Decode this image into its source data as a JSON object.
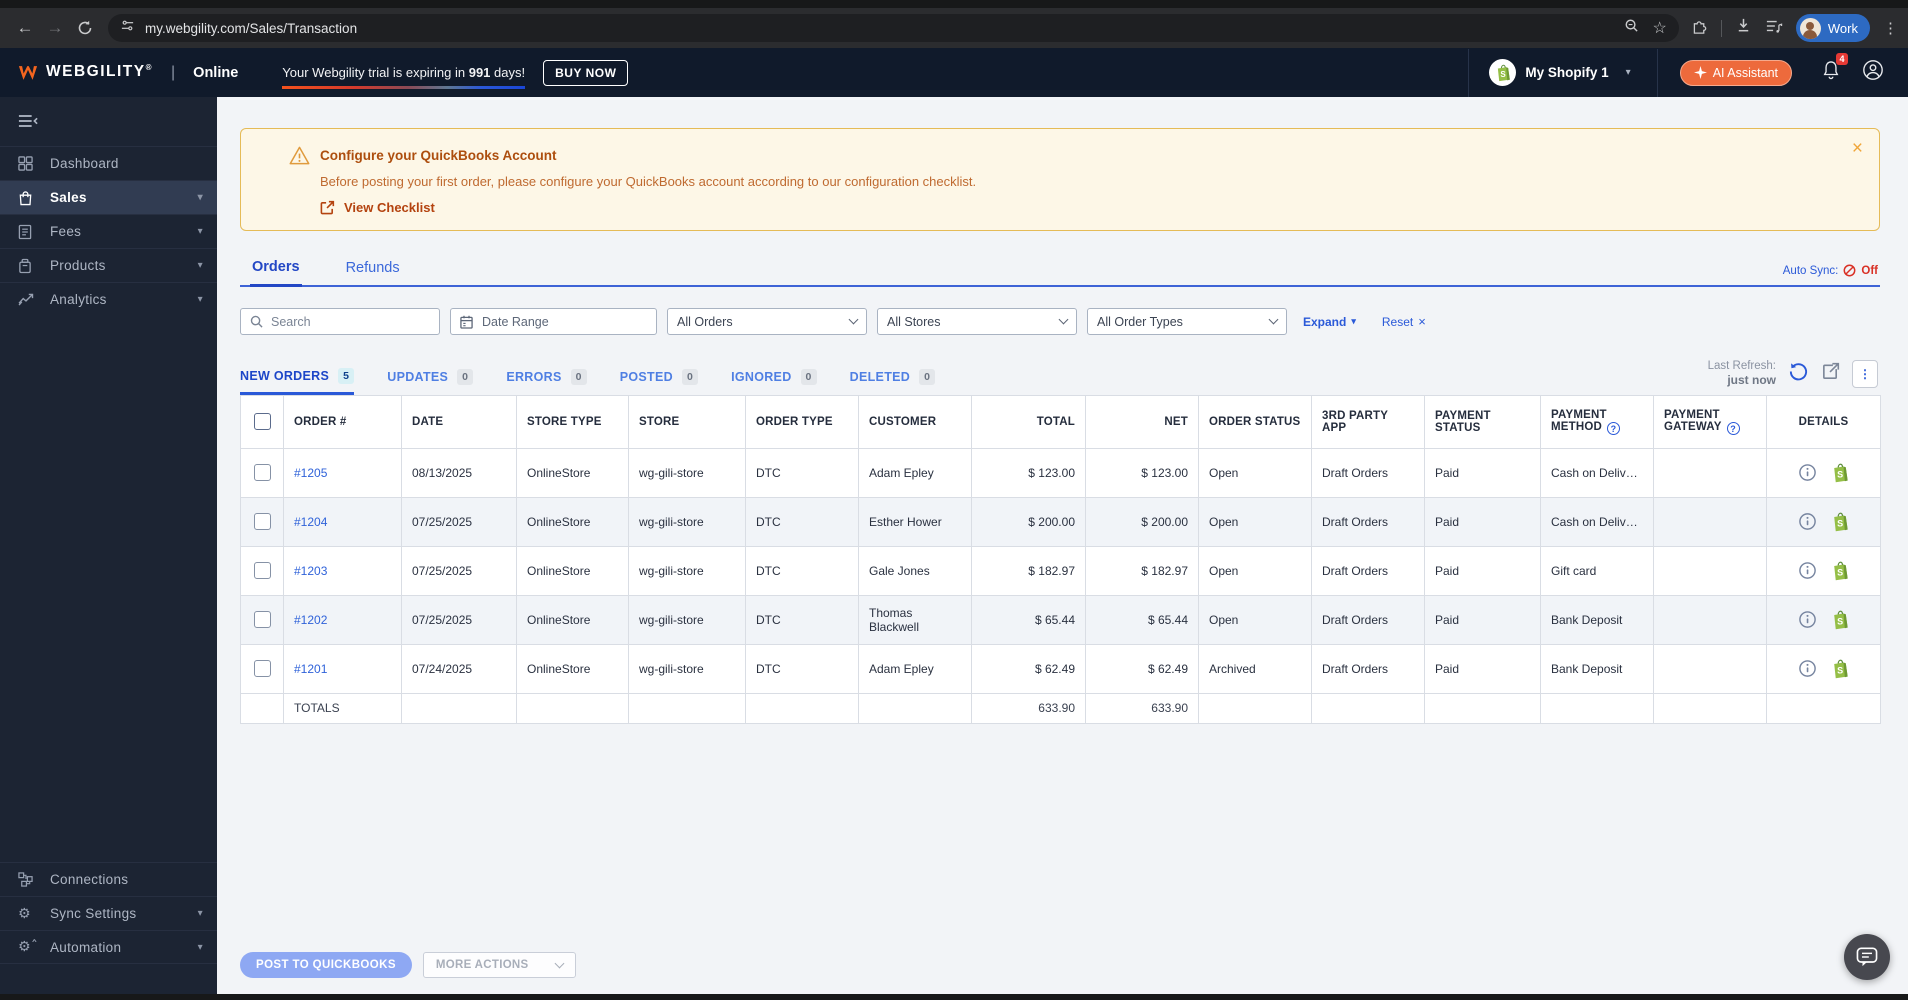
{
  "colors": {
    "brand_orange": "#f4651f",
    "accent_blue": "#2a59d8",
    "auto_sync_off_red": "#d93025",
    "shopify_green": "#95bf47",
    "banner_border": "#e5bb57",
    "header_navy": "#101a2b"
  },
  "browser": {
    "url": "my.webgility.com/Sales/Transaction",
    "profile": "Work"
  },
  "header": {
    "brand": "WEBGILITY",
    "reg": "®",
    "divider": "|",
    "mode": "Online",
    "trial_prefix": "Your Webgility trial is expiring in ",
    "trial_days": "991",
    "trial_suffix": " days!",
    "buy_now": "BUY NOW",
    "store": "My Shopify 1",
    "ai_assistant": "AI Assistant",
    "bell_count": "4"
  },
  "sidebar": {
    "items": [
      {
        "label": "Dashboard"
      },
      {
        "label": "Sales"
      },
      {
        "label": "Fees"
      },
      {
        "label": "Products"
      },
      {
        "label": "Analytics"
      }
    ],
    "bottom_items": [
      {
        "label": "Connections"
      },
      {
        "label": "Sync Settings"
      },
      {
        "label": "Automation"
      }
    ]
  },
  "banner": {
    "title": "Configure your QuickBooks Account",
    "body": "Before posting your first order, please configure your QuickBooks account according to our configuration checklist.",
    "link": "View Checklist"
  },
  "page_tabs": [
    {
      "label": "Orders"
    },
    {
      "label": "Refunds"
    }
  ],
  "auto_sync": {
    "label": "Auto Sync:",
    "value": "Off"
  },
  "filters": {
    "search_placeholder": "Search",
    "date_range": "Date Range",
    "orders_filter": "All Orders",
    "stores_filter": "All Stores",
    "order_types_filter": "All Order Types",
    "expand": "Expand",
    "reset": "Reset"
  },
  "subtabs": [
    {
      "label": "NEW ORDERS",
      "count": "5"
    },
    {
      "label": "UPDATES",
      "count": "0"
    },
    {
      "label": "ERRORS",
      "count": "0"
    },
    {
      "label": "POSTED",
      "count": "0"
    },
    {
      "label": "IGNORED",
      "count": "0"
    },
    {
      "label": "DELETED",
      "count": "0"
    }
  ],
  "refresh": {
    "label": "Last Refresh:",
    "value": "just now"
  },
  "table": {
    "columns": [
      "ORDER #",
      "DATE",
      "STORE TYPE",
      "STORE",
      "ORDER TYPE",
      "CUSTOMER",
      "TOTAL",
      "NET",
      "ORDER STATUS",
      "3RD PARTY APP",
      "PAYMENT STATUS",
      "PAYMENT METHOD",
      "PAYMENT GATEWAY",
      "DETAILS"
    ],
    "rows": [
      {
        "order_no": "#1205",
        "date": "08/13/2025",
        "store_type": "OnlineStore",
        "store": "wg-gili-store",
        "order_type": "DTC",
        "customer": "Adam Epley",
        "total": "$ 123.00",
        "net": "$ 123.00",
        "order_status": "Open",
        "third_party_app": "Draft Orders",
        "payment_status": "Paid",
        "payment_method": "Cash on Delivery …",
        "payment_gateway": ""
      },
      {
        "order_no": "#1204",
        "date": "07/25/2025",
        "store_type": "OnlineStore",
        "store": "wg-gili-store",
        "order_type": "DTC",
        "customer": "Esther Hower",
        "total": "$ 200.00",
        "net": "$ 200.00",
        "order_status": "Open",
        "third_party_app": "Draft Orders",
        "payment_status": "Paid",
        "payment_method": "Cash on Delivery …",
        "payment_gateway": ""
      },
      {
        "order_no": "#1203",
        "date": "07/25/2025",
        "store_type": "OnlineStore",
        "store": "wg-gili-store",
        "order_type": "DTC",
        "customer": "Gale Jones",
        "total": "$ 182.97",
        "net": "$ 182.97",
        "order_status": "Open",
        "third_party_app": "Draft Orders",
        "payment_status": "Paid",
        "payment_method": "Gift card",
        "payment_gateway": ""
      },
      {
        "order_no": "#1202",
        "date": "07/25/2025",
        "store_type": "OnlineStore",
        "store": "wg-gili-store",
        "order_type": "DTC",
        "customer": "Thomas Blackwell",
        "total": "$ 65.44",
        "net": "$ 65.44",
        "order_status": "Open",
        "third_party_app": "Draft Orders",
        "payment_status": "Paid",
        "payment_method": "Bank Deposit",
        "payment_gateway": ""
      },
      {
        "order_no": "#1201",
        "date": "07/24/2025",
        "store_type": "OnlineStore",
        "store": "wg-gili-store",
        "order_type": "DTC",
        "customer": "Adam Epley",
        "total": "$ 62.49",
        "net": "$ 62.49",
        "order_status": "Archived",
        "third_party_app": "Draft Orders",
        "payment_status": "Paid",
        "payment_method": "Bank Deposit",
        "payment_gateway": ""
      }
    ],
    "totals": {
      "label": "TOTALS",
      "total": "633.90",
      "net": "633.90"
    }
  },
  "footer": {
    "post": "POST TO QUICKBOOKS",
    "more_actions": "MORE ACTIONS"
  }
}
